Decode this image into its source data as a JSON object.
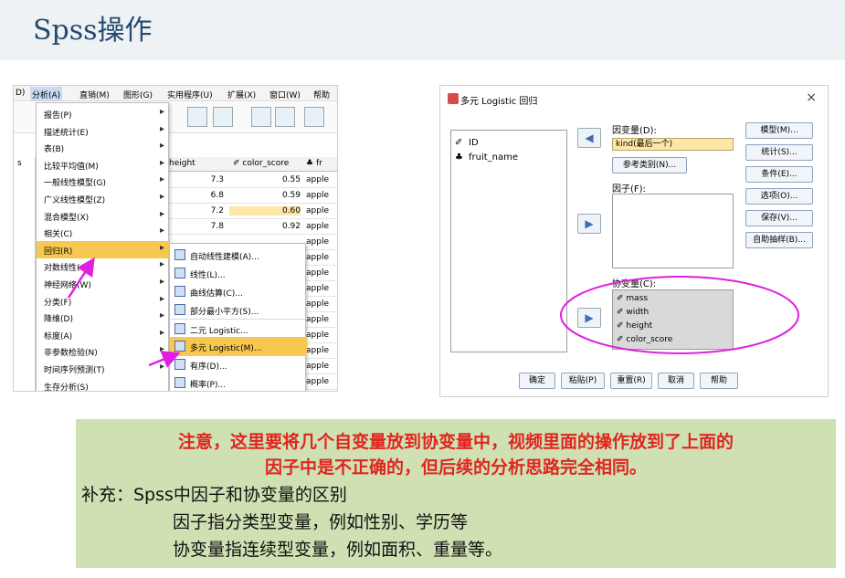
{
  "slide": {
    "title": "Spss操作"
  },
  "left_screenshot": {
    "menubar": {
      "items": [
        "分析(A)",
        "直销(M)",
        "图形(G)",
        "实用程序(U)",
        "扩展(X)",
        "窗口(W)",
        "帮助"
      ],
      "first_partial": "D)"
    },
    "analyze_menu": {
      "items": [
        {
          "label": "报告(P)"
        },
        {
          "label": "描述统计(E)"
        },
        {
          "label": "表(B)"
        },
        {
          "label": "比较平均值(M)"
        },
        {
          "label": "一般线性模型(G)"
        },
        {
          "label": "广义线性模型(Z)"
        },
        {
          "label": "混合模型(X)"
        },
        {
          "label": "相关(C)"
        },
        {
          "label": "回归(R)"
        },
        {
          "label": "对数线性(O)"
        },
        {
          "label": "神经网络(W)"
        },
        {
          "label": "分类(F)"
        },
        {
          "label": "降维(D)"
        },
        {
          "label": "标度(A)"
        },
        {
          "label": "非参数检验(N)"
        },
        {
          "label": "时间序列预测(T)"
        },
        {
          "label": "生存分析(S)"
        }
      ],
      "selected": "回归(R)"
    },
    "regression_submenu": {
      "items": [
        "自动线性建模(A)...",
        "线性(L)...",
        "曲线估算(C)...",
        "部分最小平方(S)...",
        "二元 Logistic...",
        "多元 Logistic(M)...",
        "有序(D)...",
        "概率(P)..."
      ],
      "selected": "多元 Logistic(M)..."
    },
    "grid": {
      "stub_label": "s",
      "headers": [
        "height",
        "color_score",
        "fr"
      ],
      "rows": [
        [
          "7.3",
          "0.55",
          "apple"
        ],
        [
          "6.8",
          "0.59",
          "apple"
        ],
        [
          "7.2",
          "0.60",
          "apple"
        ],
        [
          "7.8",
          "0.92",
          "apple"
        ],
        [
          "",
          "",
          "apple"
        ],
        [
          "",
          "",
          "apple"
        ],
        [
          "",
          "",
          "apple"
        ],
        [
          "",
          "",
          "apple"
        ],
        [
          "",
          "",
          "apple"
        ],
        [
          "",
          "",
          "apple"
        ],
        [
          "",
          "",
          "apple"
        ],
        [
          "",
          "",
          "apple"
        ],
        [
          "",
          "",
          "apple"
        ],
        [
          "",
          "",
          "apple"
        ]
      ]
    }
  },
  "dialog": {
    "title": "多元 Logistic 回归",
    "close": "×",
    "variables": [
      "ID",
      "fruit_name"
    ],
    "dependent_label": "因变量(D):",
    "dependent_value": "kind(最后一个)",
    "reference_button": "参考类别(N)...",
    "factor_label": "因子(F):",
    "covariate_label": "协变量(C):",
    "covariates": [
      "mass",
      "width",
      "height",
      "color_score"
    ],
    "side_buttons": [
      "模型(M)...",
      "统计(S)...",
      "条件(E)...",
      "选项(O)...",
      "保存(V)...",
      "自助抽样(B)..."
    ],
    "bottom_buttons": [
      "确定",
      "粘贴(P)",
      "重置(R)",
      "取消",
      "帮助"
    ]
  },
  "note": {
    "warning_line1": "注意，这里要将几个自变量放到协变量中，视频里面的操作放到了上面的",
    "warning_line2": "因子中是不正确的，但后续的分析思路完全相同。",
    "supplement": "补充：Spss中因子和协变量的区别",
    "factor_def": "因子指分类型变量，例如性别、学历等",
    "covariate_def": "协变量指连续型变量，例如面积、重量等。"
  },
  "colors": {
    "menu_highlight": "#f7c750",
    "annotation": "#e020e0",
    "note_bg": "#cfe0b3",
    "warning_text": "#e0251f"
  }
}
